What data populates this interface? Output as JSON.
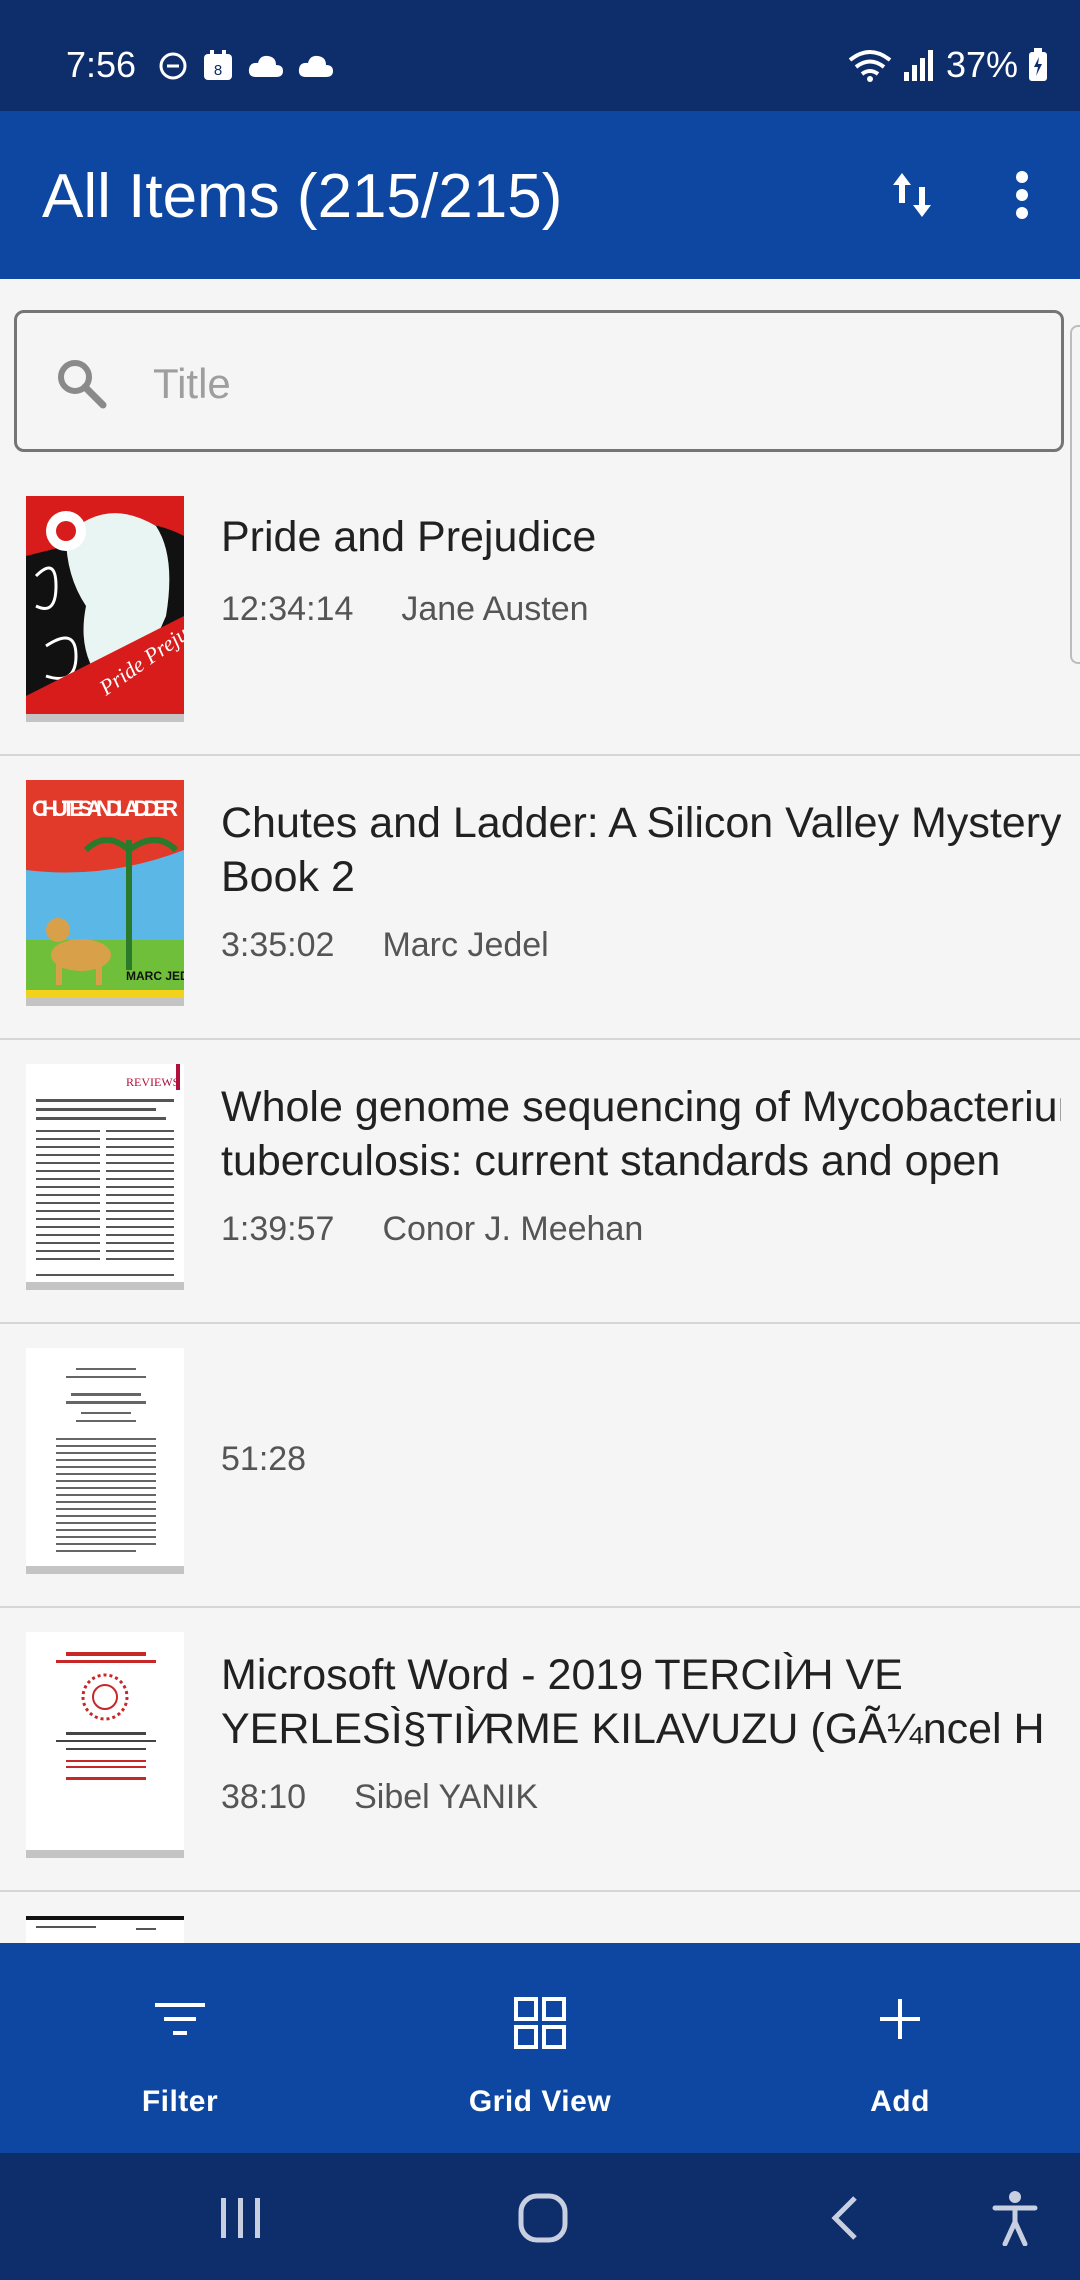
{
  "status_bar": {
    "time": "7:56",
    "battery": "37%",
    "icons": [
      "dnd-icon",
      "calendar-icon",
      "cloud-icon",
      "cloud-icon",
      "wifi-icon",
      "signal-icon",
      "battery-charging-icon"
    ],
    "calendar_day": "8"
  },
  "app_bar": {
    "title": "All Items (215/215)",
    "actions": [
      "sort-icon",
      "more-vert-icon"
    ],
    "color": "#0d47a1"
  },
  "search": {
    "placeholder": "Title",
    "value": ""
  },
  "books": [
    {
      "title": "Pride and Prejudice",
      "duration": "12:34:14",
      "author": "Jane Austen"
    },
    {
      "title": "Chutes and Ladder: A Silicon Valley Mystery\nBook 2",
      "duration": "3:35:02",
      "author": "Marc Jedel"
    },
    {
      "title": "Whole genome sequencing of Mycobacterium\ntuberculosis: current standards and open",
      "duration": "1:39:57",
      "author": "Conor J. Meehan"
    },
    {
      "title": "",
      "duration": "51:28",
      "author": ""
    },
    {
      "title": "Microsoft Word - 2019 TERCIÌ⁄H VE\nYERLESÌ§TIÌ⁄RME KILAVUZU (GÃ¼ncel H",
      "duration": "38:10",
      "author": "Sibel YANIK"
    }
  ],
  "cover_text": {
    "book1_cover": "Pride Prejudice",
    "book2_cover_title": "CHUTES AND LADDER",
    "book2_cover_author": "MARC JEDEL",
    "book3_cover": "REVIEWS"
  },
  "bottom_nav": {
    "filter_label": "Filter",
    "grid_label": "Grid View",
    "add_label": "Add"
  },
  "system_nav": [
    "recents-icon",
    "home-icon",
    "back-icon",
    "accessibility-icon"
  ]
}
